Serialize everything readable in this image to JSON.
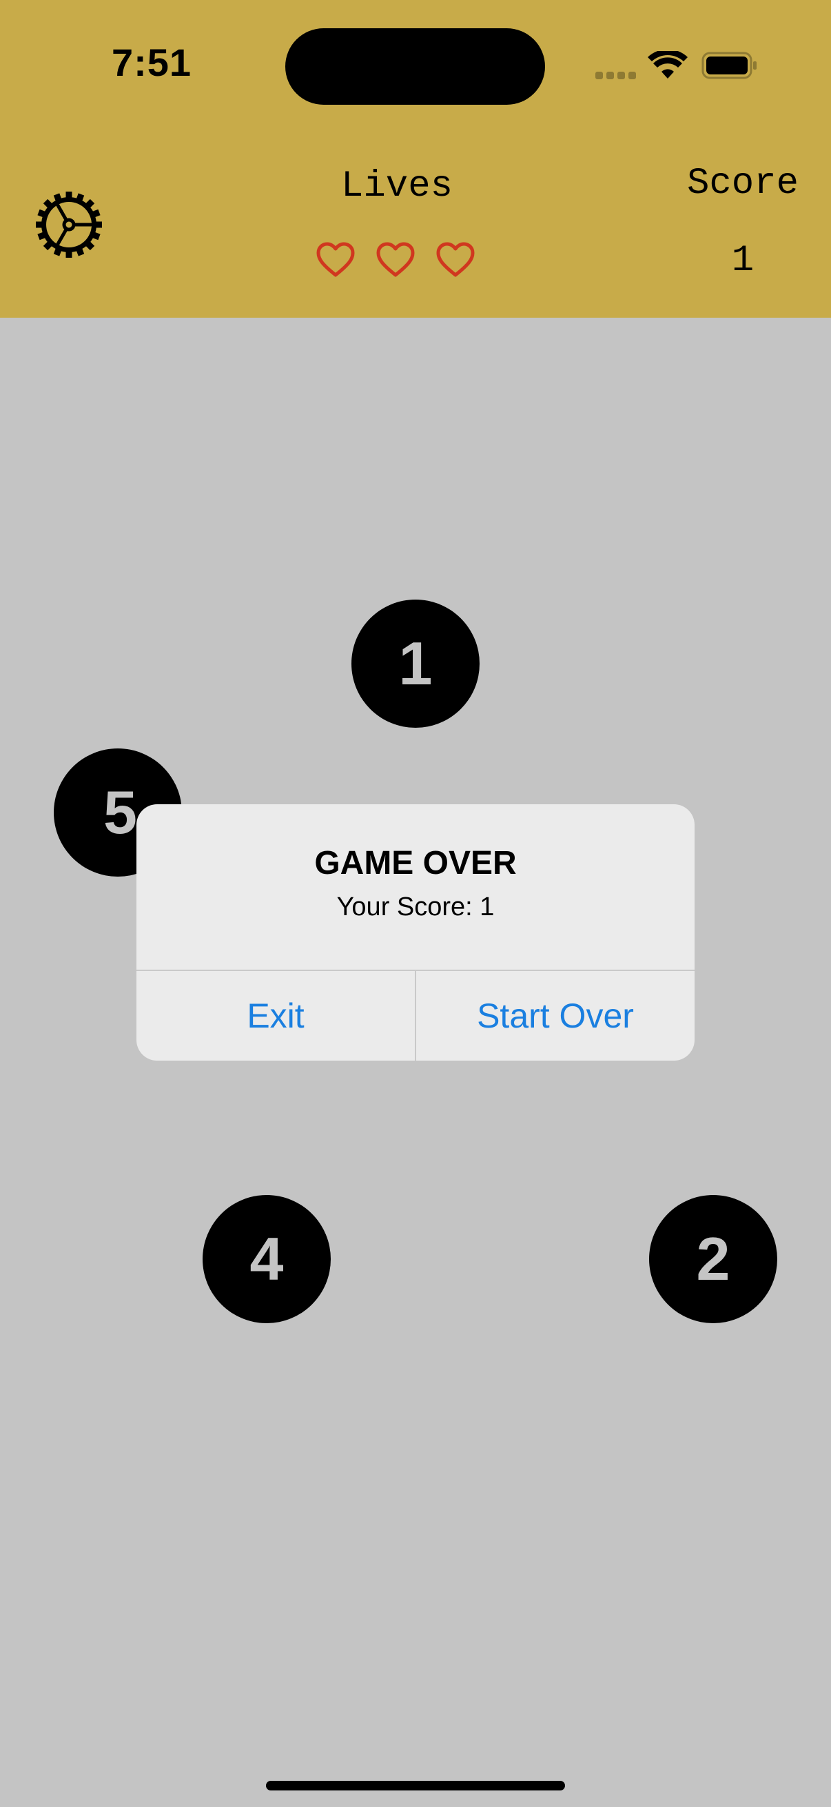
{
  "status_bar": {
    "time": "7:51",
    "icons": [
      "cellular-signal-icon",
      "wifi-icon",
      "battery-icon"
    ]
  },
  "header": {
    "settings_icon": "gear-icon",
    "lives_label": "Lives",
    "lives_count": 3,
    "heart_icon": "heart-outline-icon",
    "heart_color": "#d0371f",
    "score_label": "Score",
    "score_value": "1",
    "background_color": "#c8ab49"
  },
  "board": {
    "background_color": "#c4c4c4",
    "targets": [
      {
        "label": "1"
      },
      {
        "label": "5"
      },
      {
        "label": "4"
      },
      {
        "label": "2"
      }
    ]
  },
  "alert": {
    "title": "GAME OVER",
    "message": "Your Score: 1",
    "buttons": {
      "exit": "Exit",
      "start_over": "Start Over"
    },
    "button_color": "#1a7fe0"
  }
}
